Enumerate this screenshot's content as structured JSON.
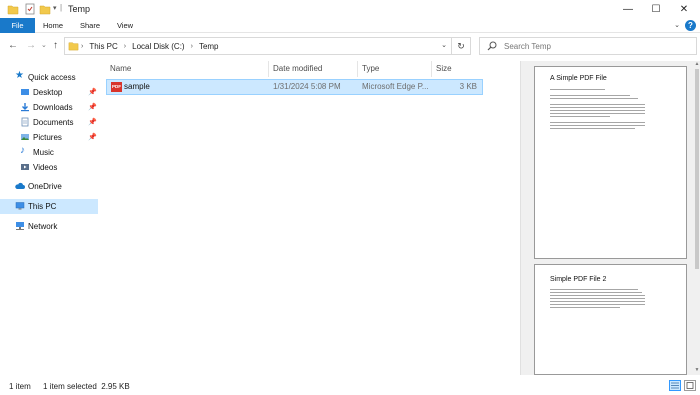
{
  "window": {
    "title": "Temp"
  },
  "ribbon": {
    "tabs": [
      "File",
      "Home",
      "Share",
      "View"
    ]
  },
  "address": {
    "crumbs": [
      "This PC",
      "Local Disk (C:)",
      "Temp"
    ],
    "search_placeholder": "Search Temp"
  },
  "nav": {
    "items": [
      {
        "label": "Quick access",
        "icon": "star-icon"
      },
      {
        "label": "Desktop",
        "icon": "desktop-folder-icon",
        "pinned": true
      },
      {
        "label": "Downloads",
        "icon": "download-folder-icon",
        "pinned": true
      },
      {
        "label": "Documents",
        "icon": "documents-folder-icon",
        "pinned": true
      },
      {
        "label": "Pictures",
        "icon": "pictures-folder-icon",
        "pinned": true
      },
      {
        "label": "Music",
        "icon": "music-folder-icon"
      },
      {
        "label": "Videos",
        "icon": "videos-folder-icon"
      },
      {
        "label": "OneDrive",
        "icon": "cloud-icon"
      },
      {
        "label": "This PC",
        "icon": "computer-icon",
        "selected": true
      },
      {
        "label": "Network",
        "icon": "network-icon"
      }
    ]
  },
  "columns": [
    "Name",
    "Date modified",
    "Type",
    "Size"
  ],
  "files": [
    {
      "name": "sample",
      "date": "1/31/2024 5:08 PM",
      "type": "Microsoft Edge P...",
      "size": "3 KB",
      "icon_text": "PDF"
    }
  ],
  "preview": {
    "page1_title": "A Simple PDF File",
    "page2_title": "Simple PDF File 2"
  },
  "status": {
    "count": "1 item",
    "selection": "1 item selected  2.95 KB"
  },
  "colors": {
    "accent": "#1979ca",
    "selection": "#cce8ff",
    "selection_border": "#99d1ff",
    "pdf_red": "#d8342b"
  }
}
